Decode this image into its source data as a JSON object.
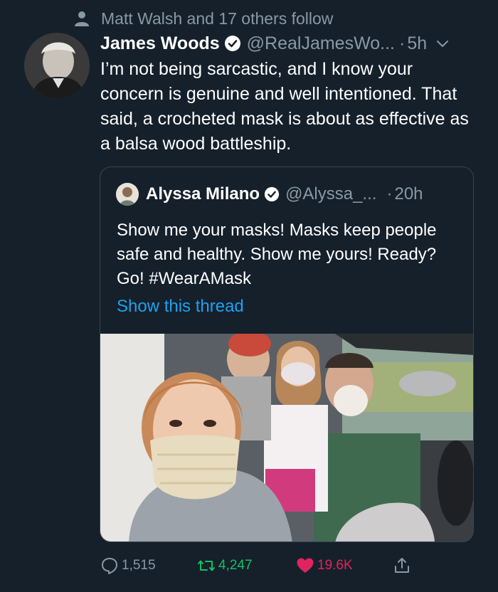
{
  "social_context": {
    "text": "Matt Walsh and 17 others follow"
  },
  "tweet": {
    "display_name": "James Woods",
    "handle": "@RealJamesWo...",
    "dot": "·",
    "time": "5h",
    "text": "I’m not being sarcastic, and I know your concern is genuine and well intentioned. That said, a crocheted mask is about as effective as a balsa wood battleship."
  },
  "quote": {
    "display_name": "Alyssa Milano",
    "handle": "@Alyssa_...",
    "dot": "·",
    "time": "20h",
    "text": "Show me your masks! Masks keep people safe and healthy. Show me yours! Ready? Go! #WearAMask",
    "show_thread": "Show this thread"
  },
  "actions": {
    "replies": "1,515",
    "retweets": "4,247",
    "likes": "19.6K"
  },
  "colors": {
    "background": "#15202b",
    "secondary_text": "#8899a6",
    "link": "#1da1f2",
    "retweet": "#17bf63",
    "like": "#e0245e",
    "border": "#38444d"
  },
  "icons": [
    "person-icon",
    "verified-icon",
    "chevron-down-icon",
    "reply-icon",
    "retweet-icon",
    "heart-icon",
    "share-icon"
  ]
}
